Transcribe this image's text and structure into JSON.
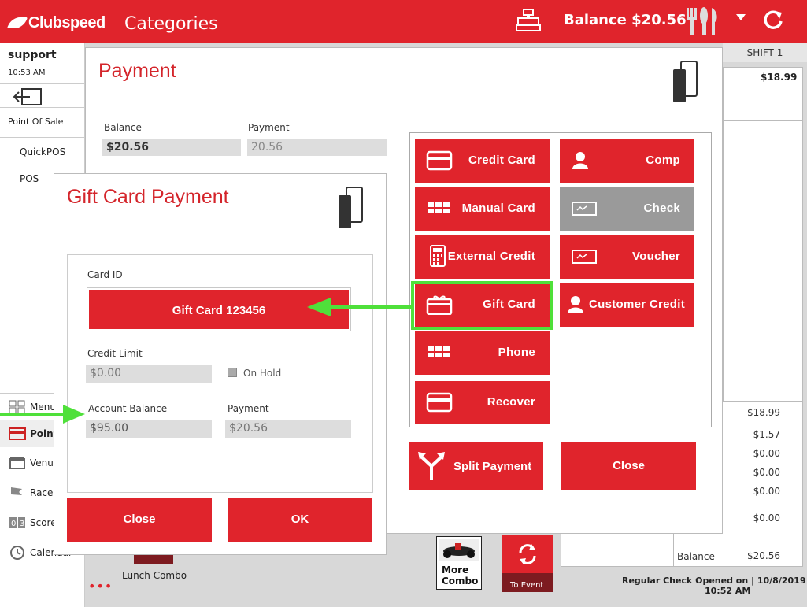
{
  "header": {
    "logo_text": "Clubspeed",
    "title": "Categories",
    "balance": "Balance $20.56"
  },
  "sidebar": {
    "user": "support",
    "time": "10:53 AM",
    "section": "Point Of Sale",
    "links": [
      "QuickPOS",
      "POS"
    ],
    "nav": [
      {
        "label": "Menu",
        "icon": "grid-icon"
      },
      {
        "label": "Point",
        "icon": "card-icon"
      },
      {
        "label": "Venu",
        "icon": "venue-icon"
      },
      {
        "label": "Race",
        "icon": "flag-icon"
      },
      {
        "label": "Score",
        "icon": "scoreboard-icon"
      },
      {
        "label": "Calendar",
        "icon": "calendar-icon"
      }
    ],
    "more": "•••"
  },
  "right": {
    "shift": "SHIFT 1",
    "receipt_amount": "$18.99",
    "totals": [
      "$18.99",
      "$1.57",
      "$0.00",
      "$0.00",
      "$0.00",
      "$0.00"
    ],
    "balance_label": "Balance",
    "balance_value": "$20.56",
    "footer_note": "Regular Check Opened on  |  10/8/2019",
    "footer_time": "10:52 AM"
  },
  "tiles": {
    "combo_label_1": "More",
    "combo_label_2": "Combo",
    "to_event": "To Event",
    "lunch": "Lunch Combo"
  },
  "payment": {
    "title": "Payment",
    "balance_label": "Balance",
    "balance_value": "$20.56",
    "payment_label": "Payment",
    "payment_value": "20.56",
    "methods": {
      "credit_card": "Credit Card",
      "comp": "Comp",
      "manual_card": "Manual Card",
      "check": "Check",
      "external_credit": "External Credit",
      "voucher": "Voucher",
      "gift_card": "Gift Card",
      "customer_credit": "Customer Credit",
      "phone": "Phone",
      "recover": "Recover"
    },
    "split_payment": "Split Payment",
    "close": "Close"
  },
  "gift_card": {
    "title": "Gift Card Payment",
    "card_id_label": "Card ID",
    "card_id_value": "Gift Card 123456",
    "credit_limit_label": "Credit Limit",
    "credit_limit_value": "$0.00",
    "on_hold_label": "On Hold",
    "account_balance_label": "Account Balance",
    "account_balance_value": "$95.00",
    "payment_label": "Payment",
    "payment_value": "$20.56",
    "close": "Close",
    "ok": "OK"
  },
  "colors": {
    "brand_red": "#e0242c",
    "highlight_green": "#4fe03a",
    "disabled_gray": "#9a9a9a"
  }
}
